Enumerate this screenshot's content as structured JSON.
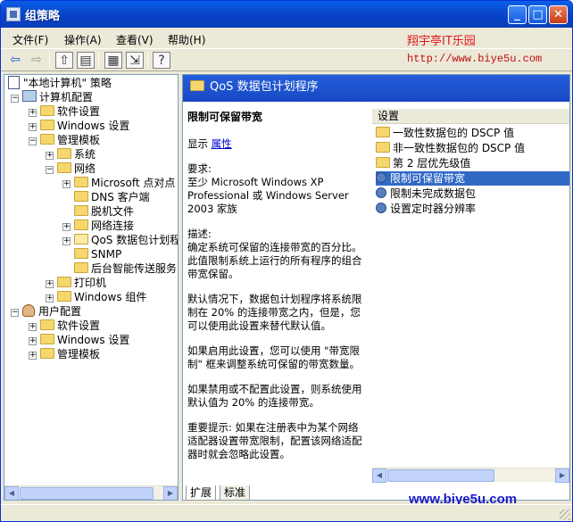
{
  "window": {
    "title": "组策略"
  },
  "menu": [
    "文件(F)",
    "操作(A)",
    "查看(V)",
    "帮助(H)"
  ],
  "watermarks": {
    "top_text": "翔宇亭IT乐园",
    "top_url": "http://www.biye5u.com",
    "bottom_url": "www.biye5u.com"
  },
  "tree": {
    "root": "\"本地计算机\" 策略",
    "computer": "计算机配置",
    "software": "软件设置",
    "windows": "Windows 设置",
    "admin": "管理模板",
    "system": "系统",
    "network": "网络",
    "ms": "Microsoft 点对点",
    "dns": "DNS 客户端",
    "offline": "脱机文件",
    "netconn": "网络连接",
    "qos": "QoS 数据包计划程序",
    "snmp": "SNMP",
    "bits": "后台智能传送服务",
    "printers": "打印机",
    "wincomp": "Windows 组件",
    "user": "用户配置",
    "u_software": "软件设置",
    "u_windows": "Windows 设置",
    "u_admin": "管理模板"
  },
  "header": {
    "title": "QoS 数据包计划程序"
  },
  "description": {
    "title": "限制可保留带宽",
    "show_label": "显示",
    "show_link": "属性",
    "requirements": "要求:\n至少 Microsoft Windows XP Professional 或 Windows Server 2003 家族",
    "desc": "描述:\n确定系统可保留的连接带宽的百分比。此值限制系统上运行的所有程序的组合带宽保留。",
    "para1": "默认情况下，数据包计划程序将系统限制在 20% 的连接带宽之内，但是，您可以使用此设置来替代默认值。",
    "para2": "如果启用此设置，您可以使用 \"带宽限制\" 框来调整系统可保留的带宽数量。",
    "para3": "如果禁用或不配置此设置，则系统使用默认值为 20% 的连接带宽。",
    "para4": "重要提示: 如果在注册表中为某个网络适配器设置带宽限制，配置该网络适配器时就会忽略此设置。"
  },
  "list": {
    "header": "设置",
    "items": [
      "一致性数据包的 DSCP 值",
      "非一致性数据包的 DSCP 值",
      "第 2 层优先级值",
      "限制可保留带宽",
      "限制未完成数据包",
      "设置定时器分辨率"
    ]
  },
  "tabs": {
    "extended": "扩展",
    "standard": "标准"
  }
}
